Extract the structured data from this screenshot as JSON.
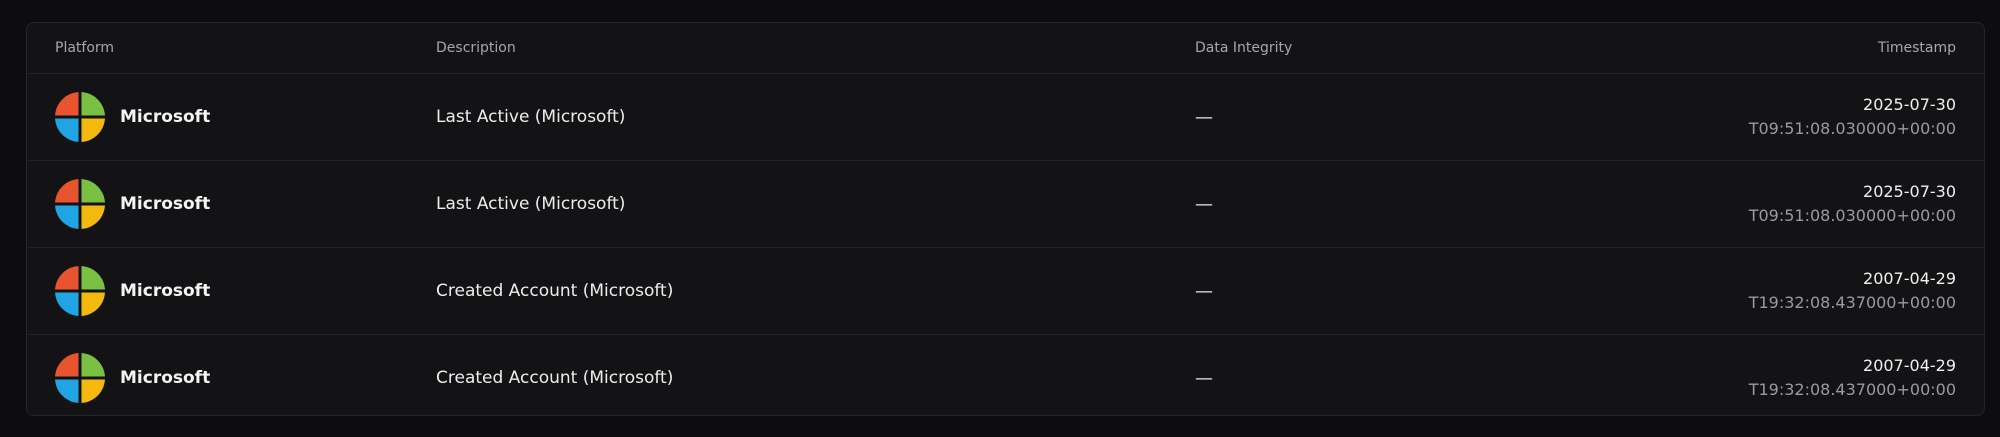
{
  "colors": {
    "background": "#0d0d0f",
    "card": "#131315",
    "ms_red": "#e8542d",
    "ms_green": "#7ac143",
    "ms_blue": "#21a4e4",
    "ms_yellow": "#f5b80f"
  },
  "table": {
    "headers": {
      "platform": "Platform",
      "description": "Description",
      "integrity": "Data Integrity",
      "timestamp": "Timestamp"
    },
    "rows": [
      {
        "platform": "Microsoft",
        "platform_icon": "microsoft-logo-icon",
        "description": "Last Active (Microsoft)",
        "integrity": "—",
        "date": "2025-07-30",
        "time": "T09:51:08.030000+00:00"
      },
      {
        "platform": "Microsoft",
        "platform_icon": "microsoft-logo-icon",
        "description": "Last Active (Microsoft)",
        "integrity": "—",
        "date": "2025-07-30",
        "time": "T09:51:08.030000+00:00"
      },
      {
        "platform": "Microsoft",
        "platform_icon": "microsoft-logo-icon",
        "description": "Created Account (Microsoft)",
        "integrity": "—",
        "date": "2007-04-29",
        "time": "T19:32:08.437000+00:00"
      },
      {
        "platform": "Microsoft",
        "platform_icon": "microsoft-logo-icon",
        "description": "Created Account (Microsoft)",
        "integrity": "—",
        "date": "2007-04-29",
        "time": "T19:32:08.437000+00:00"
      }
    ]
  }
}
